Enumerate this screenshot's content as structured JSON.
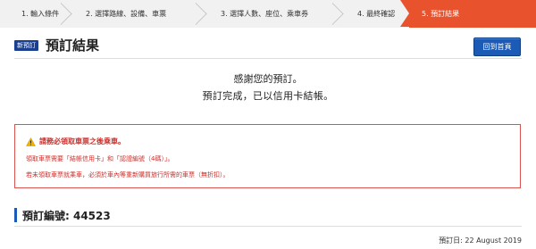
{
  "steps": [
    {
      "label": "1.  輸入條件",
      "active": false
    },
    {
      "label": "2.  選擇路線、設備、車票",
      "active": false
    },
    {
      "label": "3.  選擇人數、座位、乘車券",
      "active": false
    },
    {
      "label": "4.  最終確認",
      "active": false
    },
    {
      "label": "5.  預訂結果",
      "active": true
    }
  ],
  "header": {
    "badge": "新預訂",
    "title": "預訂結果",
    "home_button": "回到首頁"
  },
  "thanks": {
    "line1": "感謝您的預訂。",
    "line2": "預訂完成，已以信用卡結帳。"
  },
  "notice": {
    "icon": "warning-icon",
    "title": "請務必領取車票之後乘車。",
    "line1": "領取車票需要「結帳信用卡」和「認證編號（4碼）」。",
    "line2": "若未領取車票就乘車，必須於車內等重新購買旅行所需的車票（無折扣）。"
  },
  "booking": {
    "number": "預訂編號: 44523",
    "date": "預訂日: 22 August 2019"
  },
  "colors": {
    "active_step": "#e8532e",
    "primary": "#1c5bb5",
    "badge": "#1a3f8f",
    "alert": "#c9302c"
  }
}
